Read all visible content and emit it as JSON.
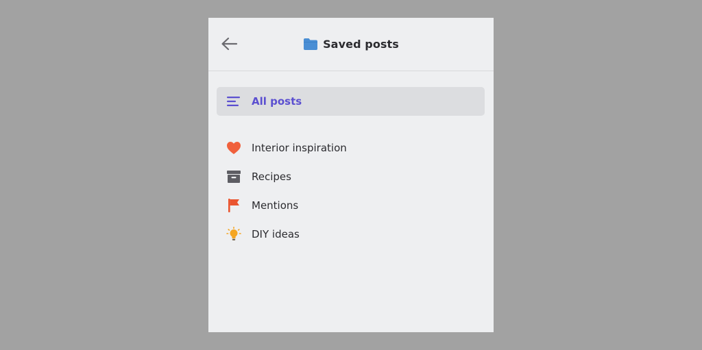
{
  "header": {
    "title": "Saved posts",
    "back_icon": "arrow-left-icon",
    "title_icon": "folder-icon",
    "folder_color": "#4a8ed4"
  },
  "nav": {
    "all_posts": {
      "label": "All posts",
      "icon": "list-lines-icon",
      "color": "#5b4fd0",
      "selected": true
    }
  },
  "collections": [
    {
      "label": "Interior inspiration",
      "icon": "heart-icon",
      "color": "#f0603c"
    },
    {
      "label": "Recipes",
      "icon": "archive-box-icon",
      "color": "#5d5d63"
    },
    {
      "label": "Mentions",
      "icon": "flag-icon",
      "color": "#ea5530"
    },
    {
      "label": "DIY ideas",
      "icon": "lightbulb-icon",
      "color": "#f5a623"
    }
  ]
}
